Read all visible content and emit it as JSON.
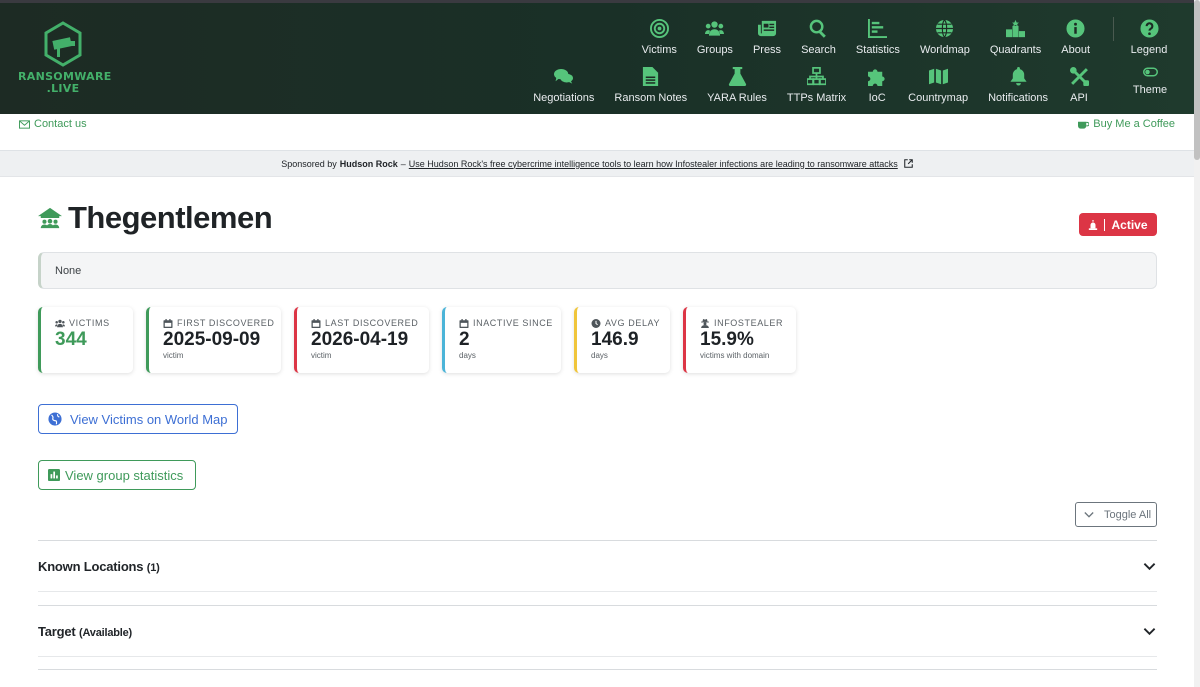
{
  "brand": {
    "logo_line1": "RANSOMWARE",
    "logo_line2": ".LIVE"
  },
  "nav": {
    "row1": [
      {
        "label": "Victims",
        "icon": "target-icon"
      },
      {
        "label": "Groups",
        "icon": "users-icon"
      },
      {
        "label": "Press",
        "icon": "newspaper-icon"
      },
      {
        "label": "Search",
        "icon": "search-icon"
      },
      {
        "label": "Statistics",
        "icon": "chart-icon"
      },
      {
        "label": "Worldmap",
        "icon": "globe-icon"
      },
      {
        "label": "Quadrants",
        "icon": "podium-icon"
      },
      {
        "label": "About",
        "icon": "info-icon"
      }
    ],
    "row2": [
      {
        "label": "Negotiations",
        "icon": "chat-icon"
      },
      {
        "label": "Ransom Notes",
        "icon": "file-icon"
      },
      {
        "label": "YARA Rules",
        "icon": "flask-icon"
      },
      {
        "label": "TTPs Matrix",
        "icon": "sitemap-icon"
      },
      {
        "label": "IoC",
        "icon": "puzzle-icon"
      },
      {
        "label": "Countrymap",
        "icon": "map-icon"
      },
      {
        "label": "Notifications",
        "icon": "bell-icon"
      },
      {
        "label": "API",
        "icon": "tools-icon"
      }
    ],
    "legend": "Legend",
    "theme": "Theme"
  },
  "contact": "Contact us",
  "coffee": "Buy Me a Coffee",
  "sponsor": {
    "prefix": "Sponsored by",
    "name": "Hudson Rock",
    "dash": "–",
    "link": "Use Hudson Rock's free cybercrime intelligence tools to learn how Infostealer infections are leading to ransomware attacks"
  },
  "group": {
    "title": "Thegentlemen",
    "status": "Active",
    "description": "None"
  },
  "stats": {
    "victims": {
      "label": "VICTIMS",
      "value": "344",
      "color": "#3f9a5a"
    },
    "first": {
      "label": "FIRST DISCOVERED",
      "value": "2025-09-09",
      "sub": "victim",
      "color": "#3f9a5a"
    },
    "last": {
      "label": "LAST DISCOVERED",
      "value": "2026-04-19",
      "sub": "victim",
      "color": "#dc3545"
    },
    "inactive": {
      "label": "INACTIVE SINCE",
      "value": "2",
      "sub": "days",
      "color": "#4bb4d8"
    },
    "delay": {
      "label": "AVG DELAY",
      "value": "146.9",
      "sub": "days",
      "color": "#f0c53a"
    },
    "infostealer": {
      "label": "INFOSTEALER",
      "value": "15.9%",
      "sub": "victims with domain",
      "color": "#dc3545"
    }
  },
  "buttons": {
    "map": "View Victims on World Map",
    "stats": "View group statistics",
    "toggle": "Toggle All"
  },
  "accordion": [
    {
      "label": "Known Locations",
      "extra": "(1)"
    },
    {
      "label": "Target",
      "extra": "(Available)"
    }
  ]
}
